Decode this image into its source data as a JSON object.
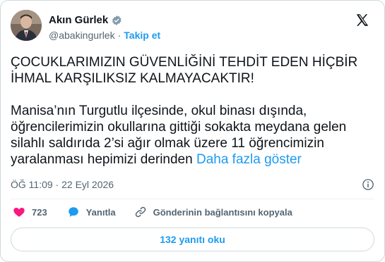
{
  "author": {
    "name": "Akın Gürlek",
    "handle": "@abakingurlek",
    "separator": "·",
    "follow_label": "Takip et",
    "verified_icon": "verified-badge-icon",
    "avatar": "profile-photo"
  },
  "brand": {
    "logo": "x-logo-icon"
  },
  "tweet": {
    "paragraph1": "ÇOCUKLARIMIZIN GÜVENLİĞİNİ TEHDİT EDEN HİÇBİR\nİHMAL KARŞILIKSIZ KALMAYACAKTIR!",
    "paragraph2": "Manisa’nın Turgutlu ilçesinde, okul binası dışında,\nöğrencilerimizin okullarına gittiği sokakta meydana gelen\nsilahlı saldırıda 2’si ağır olmak üzere 11 öğrencimizin\nyaralanması hepimizi derinden ",
    "show_more": "Daha fazla göster",
    "timestamp": "ÖĞ 11:09 · 22 Eyl 2026"
  },
  "actions": {
    "like_count": "723",
    "reply_label": "Yanıtla",
    "copy_link_label": "Gönderinin bağlantısını kopyala"
  },
  "replies_button": "132 yanıtı oku",
  "colors": {
    "accent": "#1d9bf0",
    "like": "#f91880",
    "text": "#0f1419",
    "muted": "#536471"
  }
}
